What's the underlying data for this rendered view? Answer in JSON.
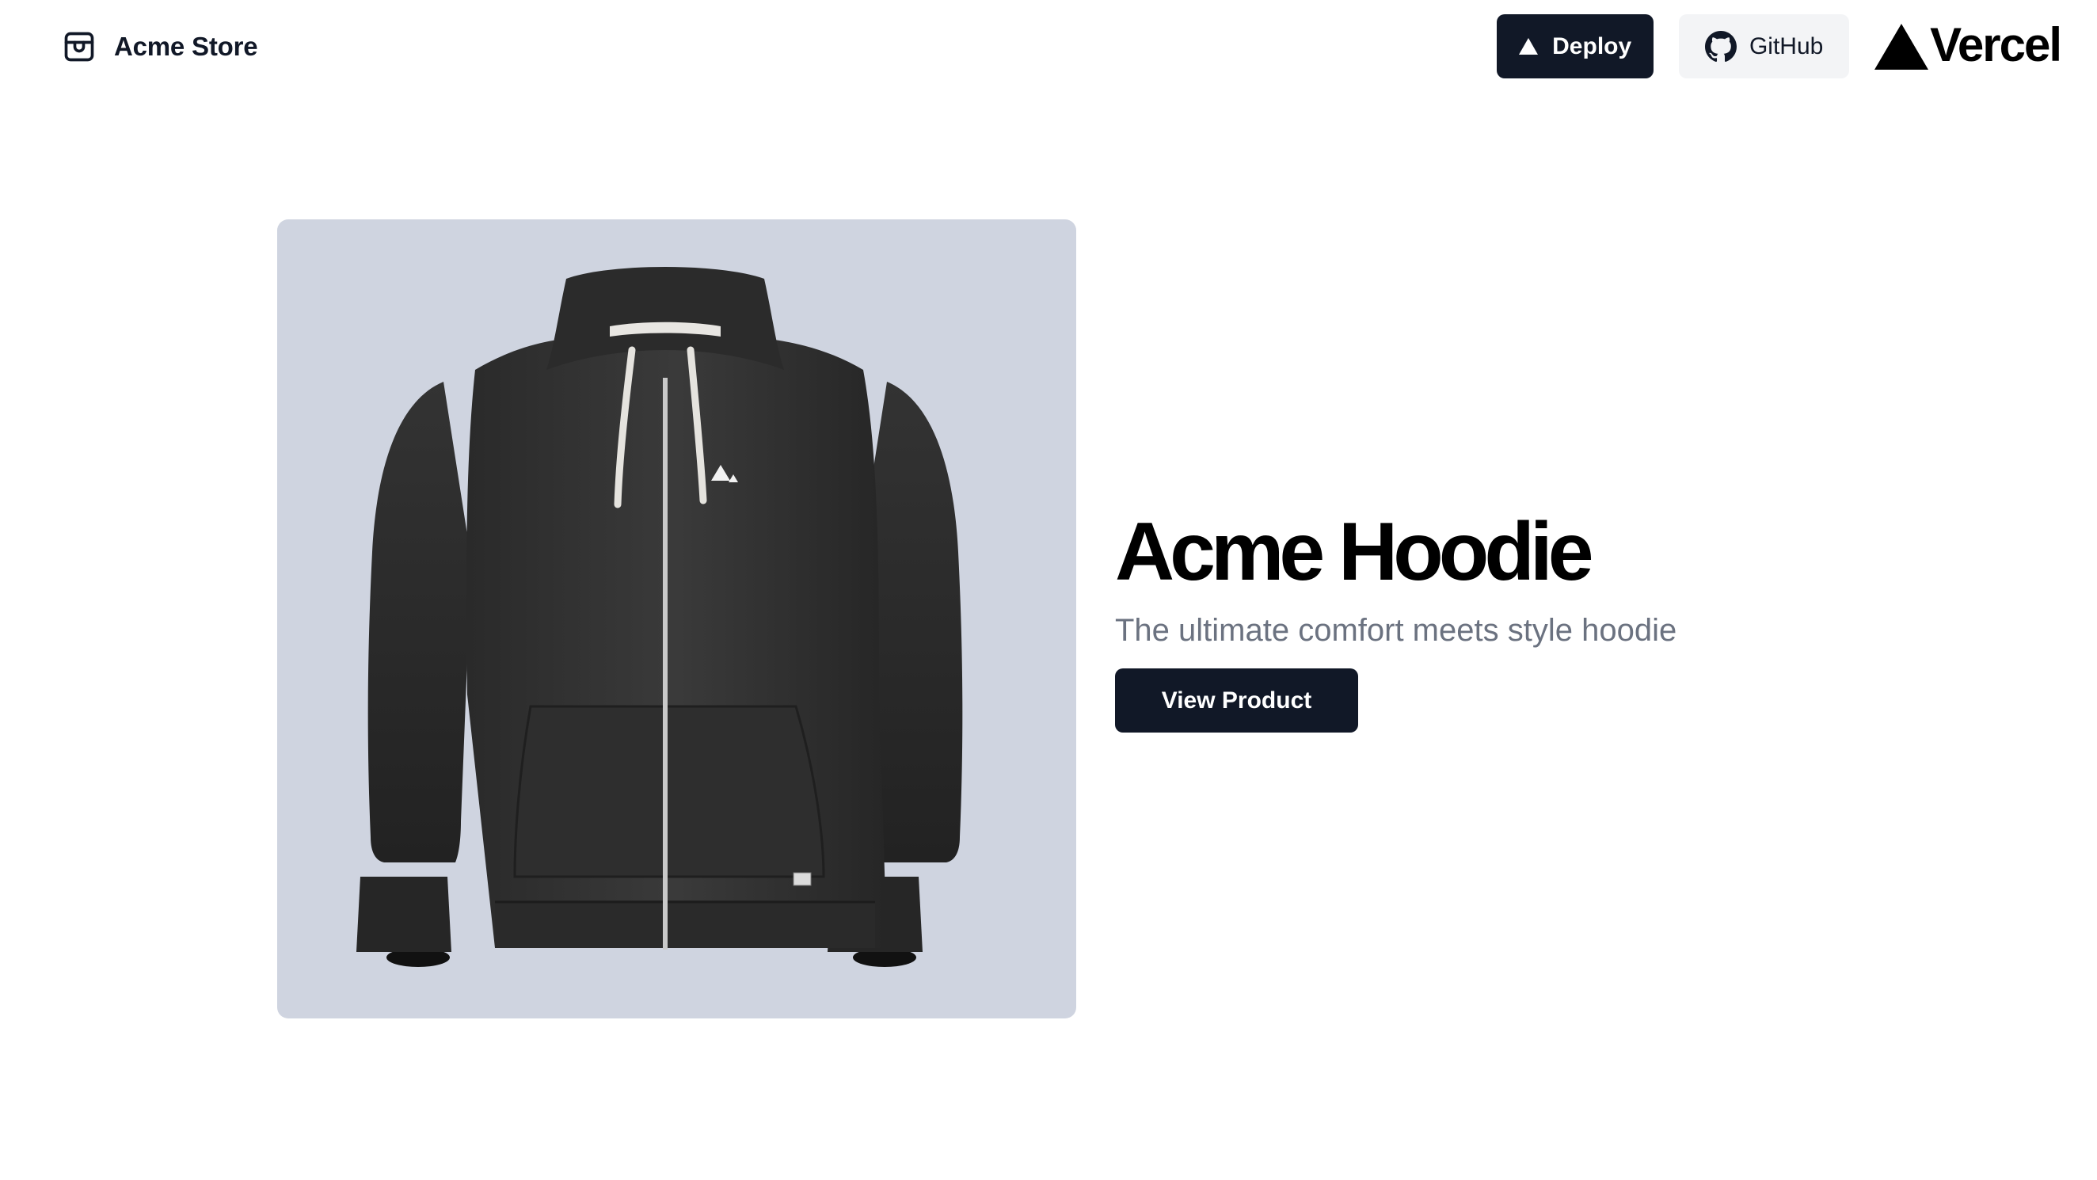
{
  "header": {
    "brand_name": "Acme Store",
    "brand_icon": "store-box-icon",
    "deploy_label": "Deploy",
    "deploy_icon": "triangle-icon",
    "github_label": "GitHub",
    "github_icon": "github-icon",
    "vercel_wordmark": "Vercel"
  },
  "product": {
    "title": "Acme Hoodie",
    "subtitle": "The ultimate comfort meets style hoodie",
    "cta_label": "View Product",
    "image_alt": "hoodie-image"
  },
  "colors": {
    "primary_button": "#111827",
    "secondary_button": "#f3f4f6",
    "card_background": "#cfd4e0",
    "subtitle_text": "#6b7280"
  }
}
